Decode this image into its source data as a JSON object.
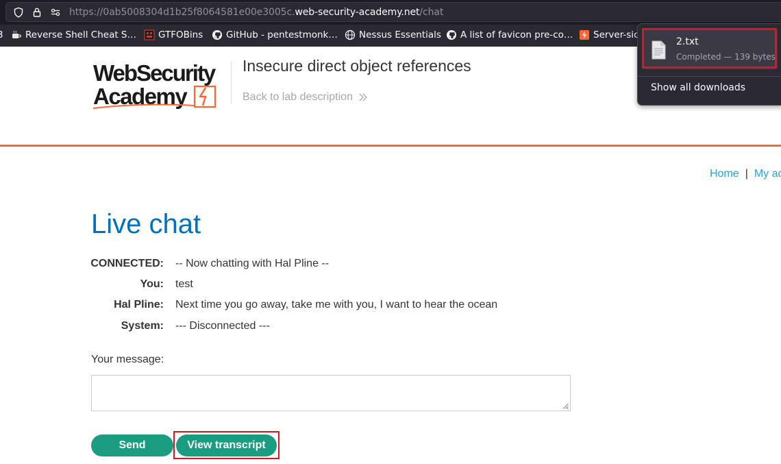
{
  "browser": {
    "url_prefix": "https://0ab5008304d1b25f8064581e00e3005c.",
    "url_host": "web-security-academy.net",
    "url_path": "/chat",
    "bookmarks": [
      {
        "label": "Reverse Shell Cheat S…",
        "icon": "coffee-icon"
      },
      {
        "label": "GTFOBins",
        "icon": "gtfobins-icon"
      },
      {
        "label": "GitHub - pentestmonk…",
        "icon": "github-icon"
      },
      {
        "label": "Nessus Essentials",
        "icon": "globe-icon"
      },
      {
        "label": "A list of favicon pre-co…",
        "icon": "github-icon"
      },
      {
        "label": "Server-sic",
        "icon": "portswigger-icon"
      }
    ]
  },
  "downloads": {
    "file_name": "2.txt",
    "status": "Completed — 139 bytes",
    "show_all": "Show all downloads"
  },
  "header": {
    "logo_line1": "WebSecurity",
    "logo_line2": "Academy",
    "lab_title": "Insecure direct object references",
    "back_link": "Back to lab description"
  },
  "nav": {
    "home": "Home",
    "separator": "|",
    "account": "My ac"
  },
  "chat": {
    "title": "Live chat",
    "lines": [
      {
        "who": "CONNECTED:",
        "text": "-- Now chatting with Hal Pline --"
      },
      {
        "who": "You:",
        "text": "test"
      },
      {
        "who": "Hal Pline:",
        "text": "Next time you go away, take me with you, I want to hear the ocean"
      },
      {
        "who": "System:",
        "text": "--- Disconnected ---"
      }
    ],
    "message_label": "Your message:",
    "send_label": "Send",
    "transcript_label": "View transcript"
  },
  "colors": {
    "accent_orange": "#ff6633",
    "title_blue": "#0071bc",
    "link_blue": "#29a1d6",
    "button_green": "#1a9c80",
    "highlight_red": "#e0141e"
  }
}
